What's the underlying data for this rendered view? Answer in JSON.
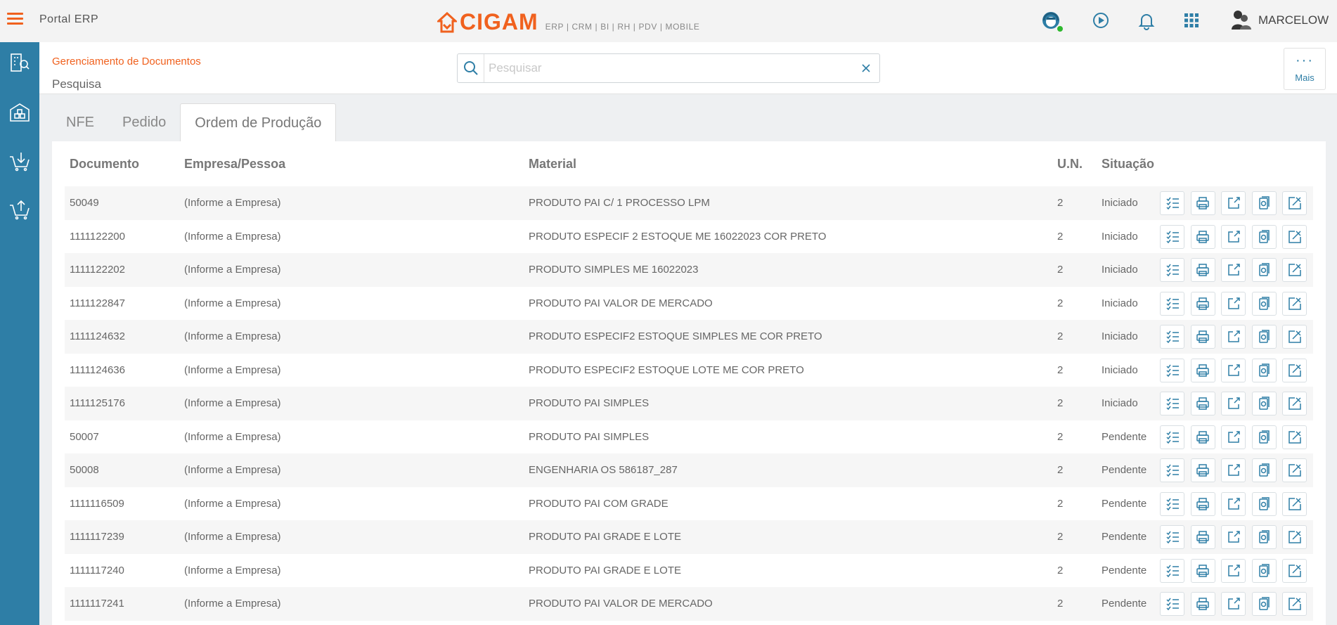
{
  "app": {
    "portal_title": "Portal ERP",
    "logo_text": "CIGAM",
    "logo_tagline": "ERP | CRM | BI | RH | PDV | MOBILE",
    "user_name": "MARCELOW",
    "accent_color": "#f0611e",
    "primary_color": "#2e7ea6"
  },
  "top_icons": [
    "support-agent-icon",
    "play-circle-icon",
    "bell-icon",
    "apps-grid-icon"
  ],
  "sidebar": {
    "items": [
      {
        "icon": "building-search-icon"
      },
      {
        "icon": "warehouse-icon"
      },
      {
        "icon": "cart-download-icon"
      },
      {
        "icon": "cart-upload-icon"
      }
    ]
  },
  "header": {
    "breadcrumb": "Gerenciamento de Documentos",
    "title": "Pesquisa",
    "search_placeholder": "Pesquisar",
    "search_value": "",
    "more_label": "Mais"
  },
  "tabs": [
    {
      "label": "NFE",
      "active": false
    },
    {
      "label": "Pedido",
      "active": false
    },
    {
      "label": "Ordem de Produção",
      "active": true
    }
  ],
  "table": {
    "columns": [
      "Documento",
      "Empresa/Pessoa",
      "Material",
      "U.N.",
      "Situação"
    ],
    "action_icons": [
      "checklist-icon",
      "printer-icon",
      "edit-icon",
      "document-copy-icon",
      "close-box-icon"
    ],
    "rows": [
      {
        "documento": "50049",
        "empresa": "(Informe a Empresa)",
        "material": "PRODUTO PAI C/ 1 PROCESSO LPM",
        "un": "2",
        "situacao": "Iniciado"
      },
      {
        "documento": "1111122200",
        "empresa": "(Informe a Empresa)",
        "material": "PRODUTO ESPECIF 2 ESTOQUE ME 16022023 COR PRETO",
        "un": "2",
        "situacao": "Iniciado"
      },
      {
        "documento": "1111122202",
        "empresa": "(Informe a Empresa)",
        "material": "PRODUTO SIMPLES ME 16022023",
        "un": "2",
        "situacao": "Iniciado"
      },
      {
        "documento": "1111122847",
        "empresa": "(Informe a Empresa)",
        "material": "PRODUTO PAI VALOR DE MERCADO",
        "un": "2",
        "situacao": "Iniciado"
      },
      {
        "documento": "1111124632",
        "empresa": "(Informe a Empresa)",
        "material": "PRODUTO ESPECIF2 ESTOQUE SIMPLES ME COR PRETO",
        "un": "2",
        "situacao": "Iniciado"
      },
      {
        "documento": "1111124636",
        "empresa": "(Informe a Empresa)",
        "material": "PRODUTO ESPECIF2 ESTOQUE LOTE ME COR PRETO",
        "un": "2",
        "situacao": "Iniciado"
      },
      {
        "documento": "1111125176",
        "empresa": "(Informe a Empresa)",
        "material": "PRODUTO PAI SIMPLES",
        "un": "2",
        "situacao": "Iniciado"
      },
      {
        "documento": "50007",
        "empresa": "(Informe a Empresa)",
        "material": "PRODUTO PAI SIMPLES",
        "un": "2",
        "situacao": "Pendente"
      },
      {
        "documento": "50008",
        "empresa": "(Informe a Empresa)",
        "material": "ENGENHARIA OS 586187_287",
        "un": "2",
        "situacao": "Pendente"
      },
      {
        "documento": "1111116509",
        "empresa": "(Informe a Empresa)",
        "material": "PRODUTO PAI COM GRADE",
        "un": "2",
        "situacao": "Pendente"
      },
      {
        "documento": "1111117239",
        "empresa": "(Informe a Empresa)",
        "material": "PRODUTO PAI GRADE E LOTE",
        "un": "2",
        "situacao": "Pendente"
      },
      {
        "documento": "1111117240",
        "empresa": "(Informe a Empresa)",
        "material": "PRODUTO PAI GRADE E LOTE",
        "un": "2",
        "situacao": "Pendente"
      },
      {
        "documento": "1111117241",
        "empresa": "(Informe a Empresa)",
        "material": "PRODUTO PAI VALOR DE MERCADO",
        "un": "2",
        "situacao": "Pendente"
      }
    ]
  }
}
